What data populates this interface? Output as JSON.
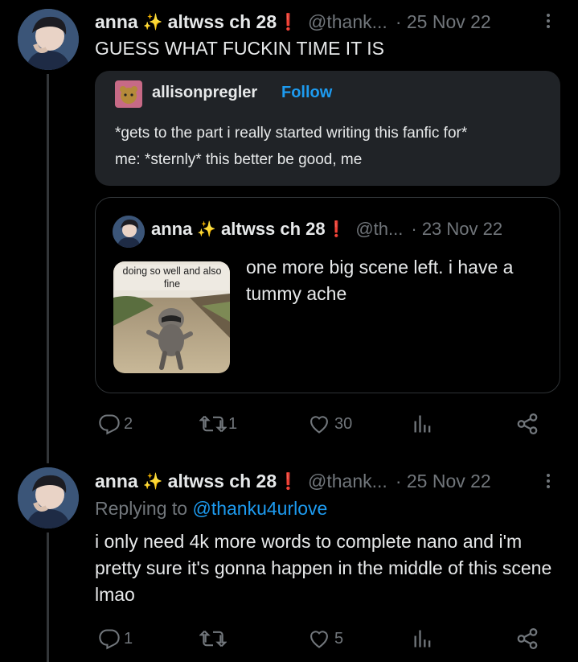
{
  "tweet1": {
    "display_name": "anna",
    "name_suffix": "altwss ch 28",
    "sparkle": "✨",
    "exclaim": "❗",
    "handle": "@thank...",
    "date": "· 25 Nov 22",
    "text": "GUESS WHAT FUCKIN TIME IT IS",
    "quote": {
      "username": "allisonpregler",
      "follow_label": "Follow",
      "text_line1": "*gets to the part i really started writing this fanfic for*",
      "text_line2": "me: *sternly* this better be good, me"
    },
    "embedded": {
      "display_name": "anna",
      "name_suffix": "altwss ch 28",
      "handle": "@th...",
      "date": "· 23 Nov 22",
      "image_caption": "doing so well and also fine",
      "text": "one more big scene left. i have a tummy ache"
    },
    "actions": {
      "replies": "2",
      "retweets": "1",
      "likes": "30"
    }
  },
  "tweet2": {
    "display_name": "anna",
    "name_suffix": "altwss ch 28",
    "handle": "@thank...",
    "date": "· 25 Nov 22",
    "replying_to_label": "Replying to",
    "replying_to_handle": "@thanku4urlove",
    "text": "i only need 4k more words to complete nano and i'm pretty sure it's gonna happen in the middle of this scene lmao",
    "actions": {
      "replies": "1",
      "retweets": "",
      "likes": "5"
    }
  },
  "colors": {
    "link": "#1d9bf0",
    "muted": "#71767b",
    "text": "#e7e9ea",
    "exclaim": "#f4212e"
  }
}
